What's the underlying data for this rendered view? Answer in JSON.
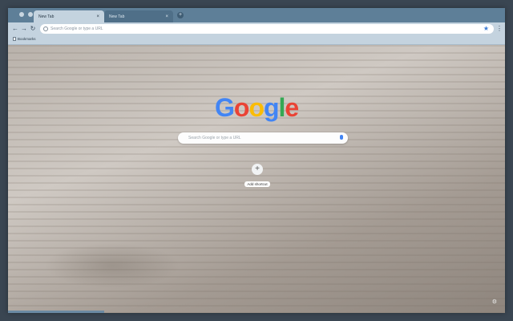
{
  "tabs": [
    {
      "title": "New Tab",
      "active": true
    },
    {
      "title": "New Tab",
      "active": false
    }
  ],
  "toolbar": {
    "omnibox_placeholder": "Search Google or type a URL"
  },
  "bookmarks": [
    {
      "label": "Bookmarks"
    }
  ],
  "ntp": {
    "logo": {
      "letters": [
        "G",
        "o",
        "o",
        "g",
        "l",
        "e"
      ],
      "colors": [
        "#4285f4",
        "#ea4335",
        "#fbbc05",
        "#4285f4",
        "#34a853",
        "#ea4335"
      ]
    },
    "search_placeholder": "Search Google or type a URL",
    "add_shortcut_label": "Add shortcut"
  },
  "colors": {
    "frame": "#6b8aa3",
    "toolbar": "#c4d3df",
    "accent": "#3b7bd4"
  }
}
